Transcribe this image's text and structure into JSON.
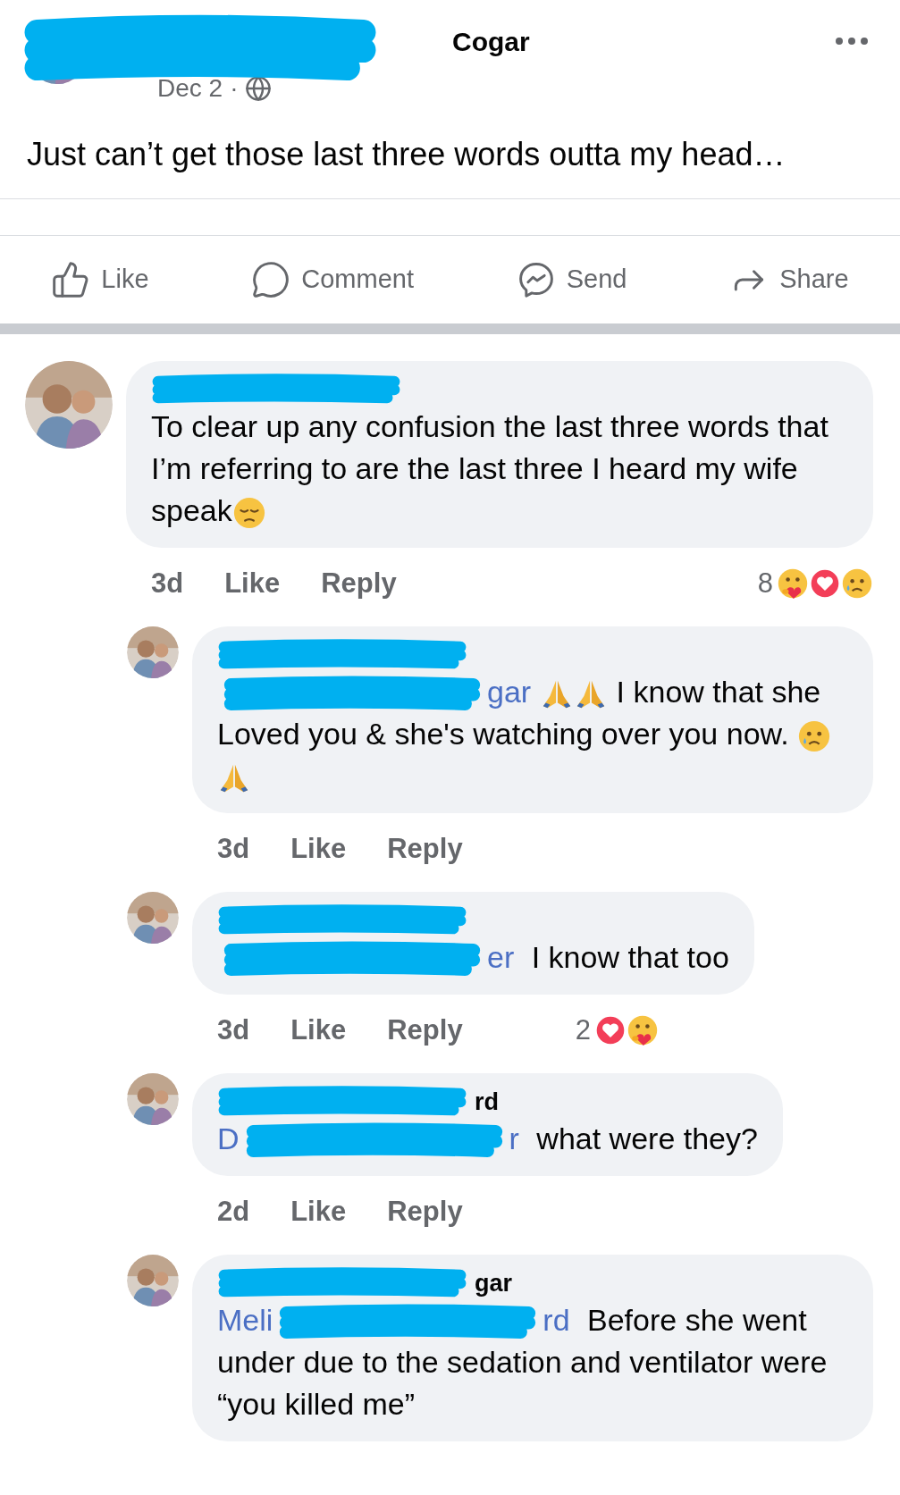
{
  "post": {
    "author_fragment": "Cogar",
    "time": "Dec 2",
    "separator": "·",
    "text": "Just can’t get those last three words outta my head…"
  },
  "actions": [
    {
      "kind": "like",
      "label": "Like"
    },
    {
      "kind": "comment",
      "label": "Comment"
    },
    {
      "kind": "send",
      "label": "Send"
    },
    {
      "kind": "share",
      "label": "Share"
    }
  ],
  "comments": [
    {
      "body": [
        {
          "kind": "text",
          "text": "To clear up any confusion the last three words that I’m referring to are the last three I heard my wife speak"
        },
        {
          "kind": "pensive"
        }
      ],
      "time": "3d",
      "like": "Like",
      "reply": "Reply",
      "reaction_count": "8",
      "reactions": [
        {
          "kind": "care"
        },
        {
          "kind": "love"
        },
        {
          "kind": "sad"
        }
      ],
      "replies": [
        {
          "body": [
            {
              "kind": "mention",
              "tail": "gar"
            },
            {
              "kind": "pray"
            },
            {
              "kind": "pray"
            },
            {
              "kind": "text",
              "text": " I know that she Loved you & she's watching over you now. "
            },
            {
              "kind": "sad"
            },
            {
              "kind": "pray"
            }
          ],
          "time": "3d",
          "like": "Like",
          "reply": "Reply"
        },
        {
          "body": [
            {
              "kind": "mention",
              "tail": "er"
            },
            {
              "kind": "text",
              "text": " I know that too"
            }
          ],
          "time": "3d",
          "like": "Like",
          "reply": "Reply",
          "reaction_count": "2",
          "reactions": [
            {
              "kind": "love"
            },
            {
              "kind": "care"
            }
          ]
        },
        {
          "name_fragment": "rd",
          "body": [
            {
              "kind": "mention",
              "head": "D",
              "tail": "r"
            },
            {
              "kind": "text",
              "text": " what were they?"
            }
          ],
          "time": "2d",
          "like": "Like",
          "reply": "Reply"
        },
        {
          "name_fragment": "gar",
          "body": [
            {
              "kind": "mention",
              "head": "Meli",
              "tail": "rd"
            },
            {
              "kind": "text",
              "text": " Before she went under due to the sedation and ventilator were “you killed me”"
            }
          ]
        }
      ]
    }
  ]
}
